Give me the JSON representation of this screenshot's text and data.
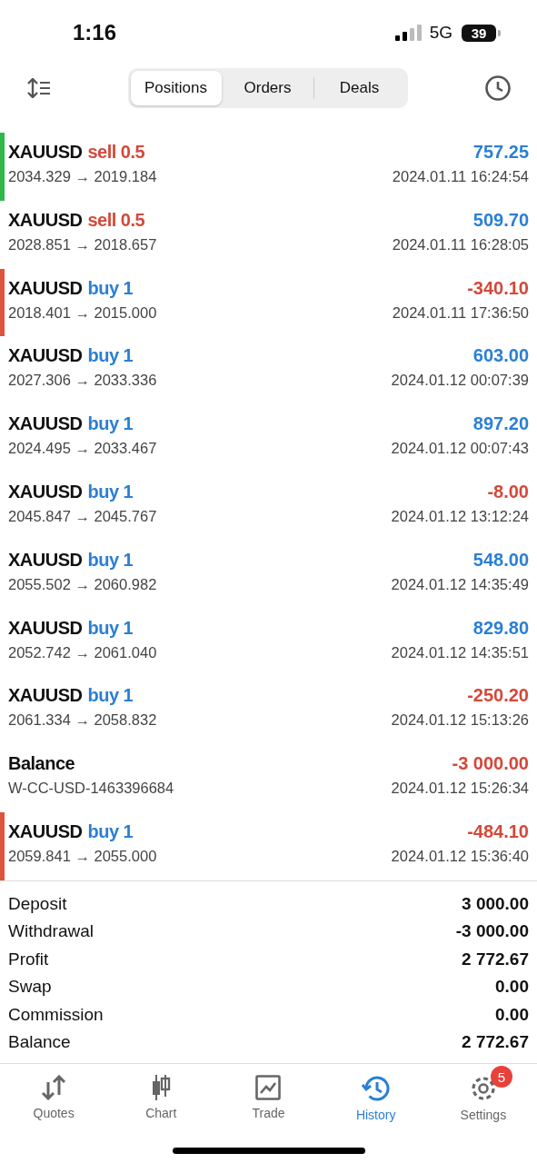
{
  "status_bar": {
    "time": "1:16",
    "network": "5G",
    "battery": "39"
  },
  "tabs": [
    {
      "label": "Positions",
      "selected": true
    },
    {
      "label": "Orders",
      "selected": false
    },
    {
      "label": "Deals",
      "selected": false
    }
  ],
  "deals": [
    {
      "kind": "trade",
      "symbol": "XAUUSD",
      "action": "sell 0.5",
      "sell": true,
      "prices": "2034.329 → 2019.184",
      "profit": "757.25",
      "loss": false,
      "time": "2024.01.11 16:24:54",
      "color": "#2fb94b"
    },
    {
      "kind": "trade",
      "symbol": "XAUUSD",
      "action": "sell 0.5",
      "sell": true,
      "prices": "2028.851 → 2018.657",
      "profit": "509.70",
      "loss": false,
      "time": "2024.01.11 16:28:05"
    },
    {
      "kind": "trade",
      "symbol": "XAUUSD",
      "action": "buy 1",
      "sell": false,
      "prices": "2018.401 → 2015.000",
      "profit": "-340.10",
      "loss": true,
      "time": "2024.01.11 17:36:50",
      "color": "#e0533f"
    },
    {
      "kind": "trade",
      "symbol": "XAUUSD",
      "action": "buy 1",
      "sell": false,
      "prices": "2027.306 → 2033.336",
      "profit": "603.00",
      "loss": false,
      "time": "2024.01.12 00:07:39"
    },
    {
      "kind": "trade",
      "symbol": "XAUUSD",
      "action": "buy 1",
      "sell": false,
      "prices": "2024.495 → 2033.467",
      "profit": "897.20",
      "loss": false,
      "time": "2024.01.12 00:07:43"
    },
    {
      "kind": "trade",
      "symbol": "XAUUSD",
      "action": "buy 1",
      "sell": false,
      "prices": "2045.847 → 2045.767",
      "profit": "-8.00",
      "loss": true,
      "time": "2024.01.12 13:12:24"
    },
    {
      "kind": "trade",
      "symbol": "XAUUSD",
      "action": "buy 1",
      "sell": false,
      "prices": "2055.502 → 2060.982",
      "profit": "548.00",
      "loss": false,
      "time": "2024.01.12 14:35:49"
    },
    {
      "kind": "trade",
      "symbol": "XAUUSD",
      "action": "buy 1",
      "sell": false,
      "prices": "2052.742 → 2061.040",
      "profit": "829.80",
      "loss": false,
      "time": "2024.01.12 14:35:51"
    },
    {
      "kind": "trade",
      "symbol": "XAUUSD",
      "action": "buy 1",
      "sell": false,
      "prices": "2061.334 → 2058.832",
      "profit": "-250.20",
      "loss": true,
      "time": "2024.01.12 15:13:26"
    },
    {
      "kind": "balance",
      "symbol": "Balance",
      "prices": "W-CC-USD-1463396684",
      "profit": "-3 000.00",
      "loss": true,
      "time": "2024.01.12 15:26:34"
    },
    {
      "kind": "trade",
      "symbol": "XAUUSD",
      "action": "buy 1",
      "sell": false,
      "prices": "2059.841 → 2055.000",
      "profit": "-484.10",
      "loss": true,
      "time": "2024.01.12 15:36:40",
      "color": "#e0533f"
    }
  ],
  "summary": [
    {
      "label": "Deposit",
      "value": "3 000.00"
    },
    {
      "label": "Withdrawal",
      "value": "-3 000.00"
    },
    {
      "label": "Profit",
      "value": "2 772.67"
    },
    {
      "label": "Swap",
      "value": "0.00"
    },
    {
      "label": "Commission",
      "value": "0.00"
    },
    {
      "label": "Balance",
      "value": "2 772.67"
    }
  ],
  "bottom_nav": [
    {
      "label": "Quotes",
      "selected": false
    },
    {
      "label": "Chart",
      "selected": false
    },
    {
      "label": "Trade",
      "selected": false
    },
    {
      "label": "History",
      "selected": true
    },
    {
      "label": "Settings",
      "selected": false,
      "badge": "5"
    }
  ]
}
